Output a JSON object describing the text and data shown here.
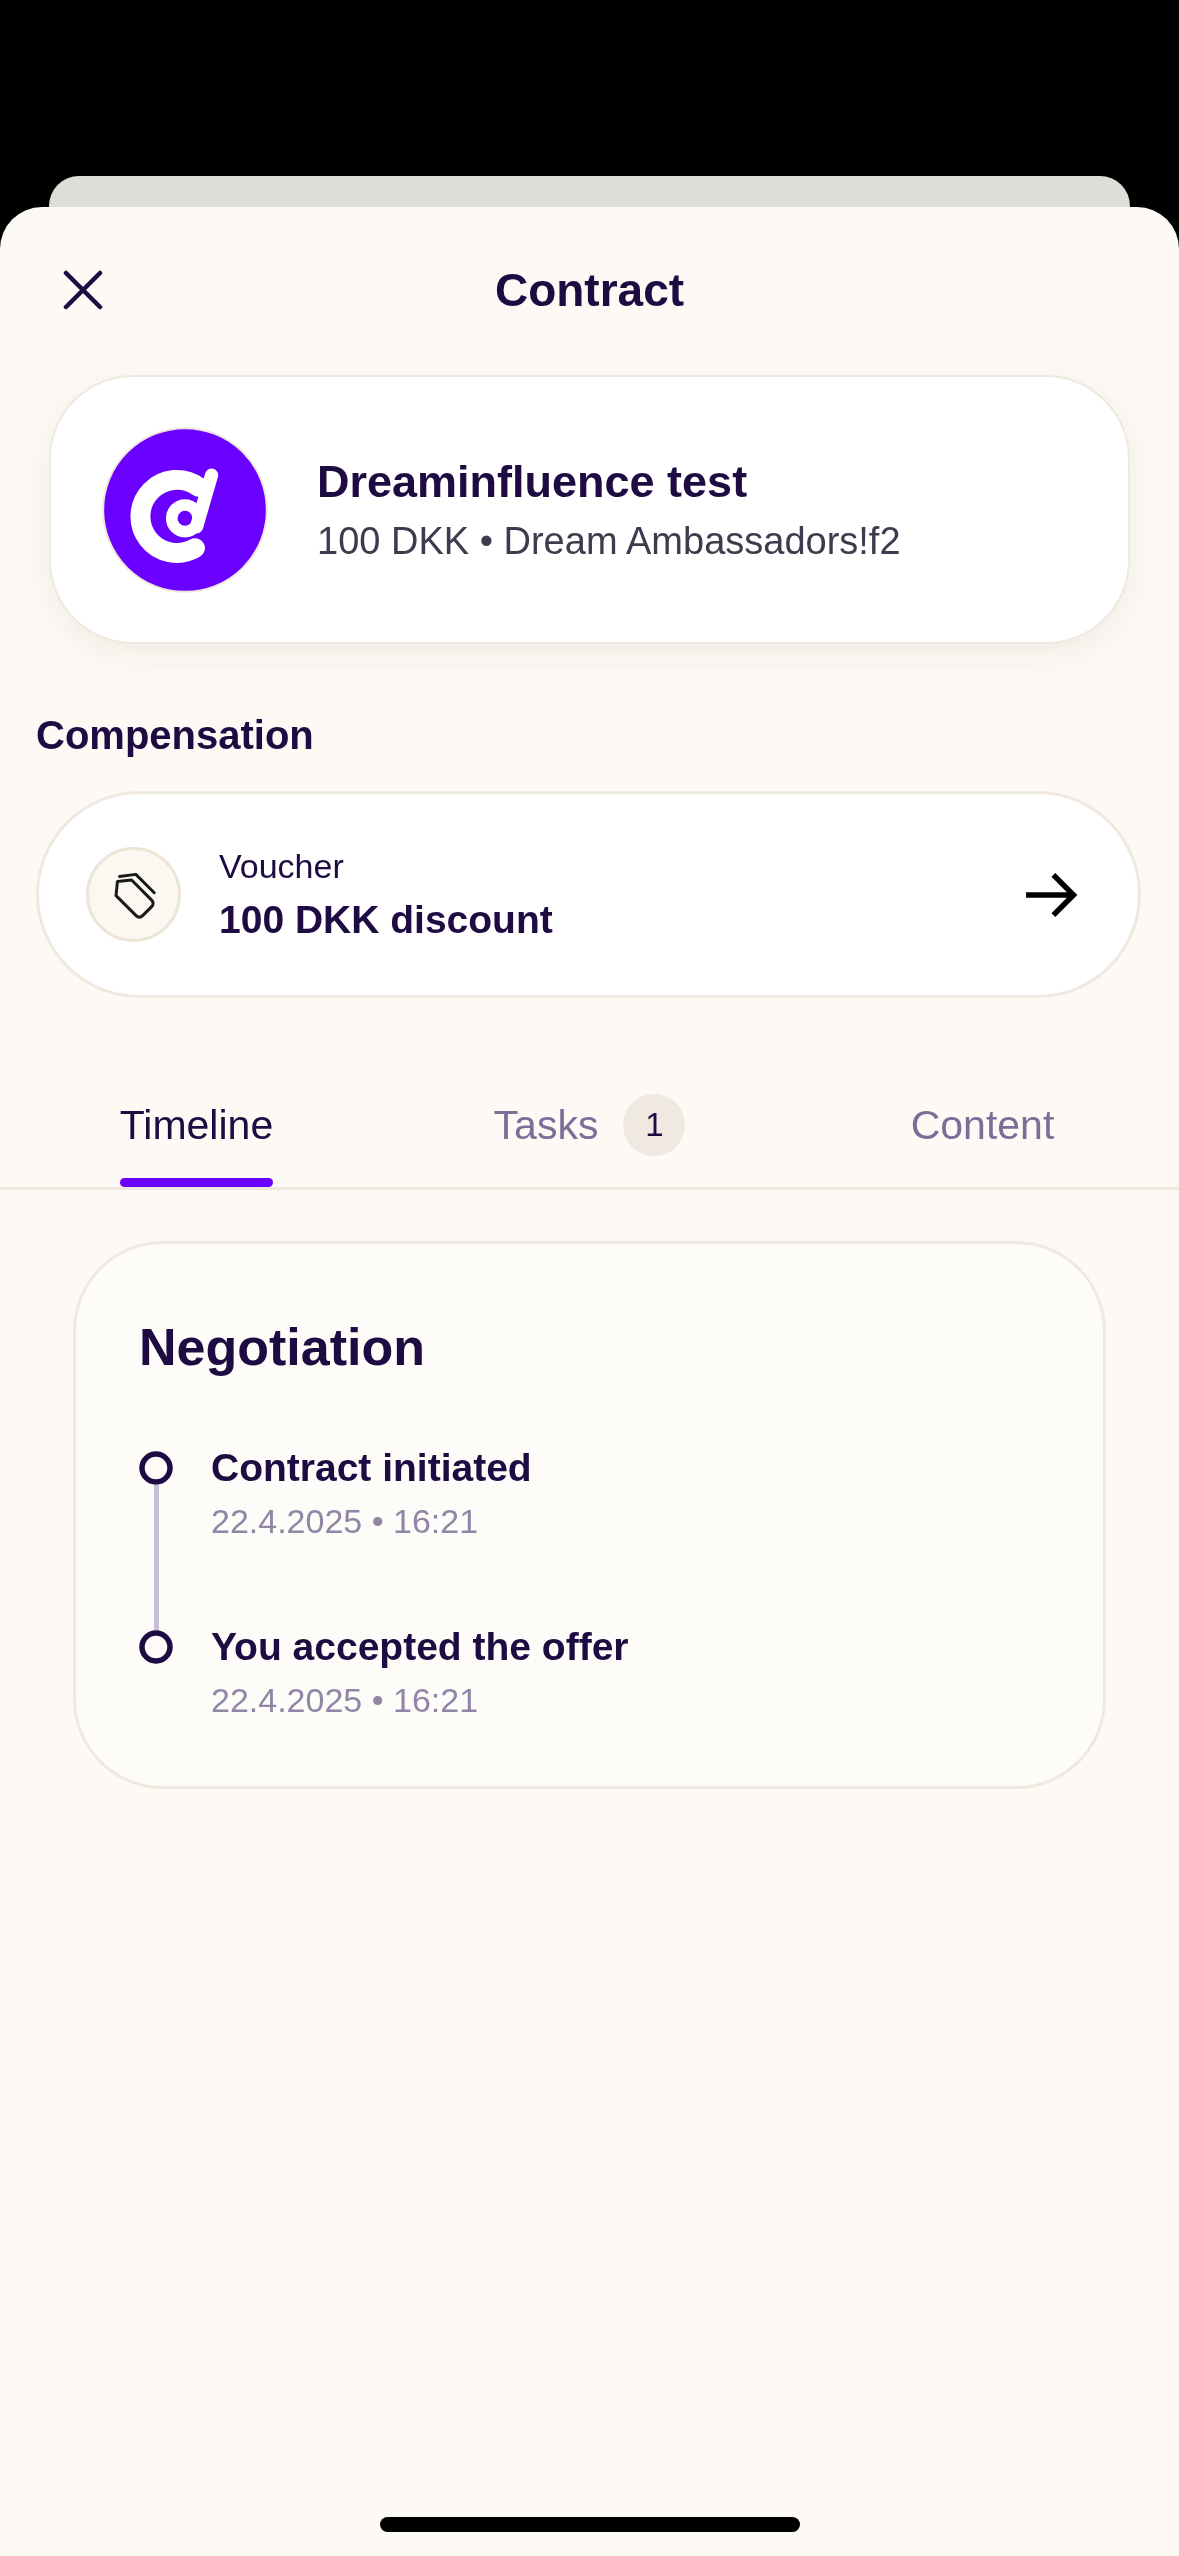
{
  "header": {
    "title": "Contract"
  },
  "contract": {
    "name": "Dreaminfluence test",
    "details": "100 DKK • Dream Ambassadors!f2"
  },
  "compensation": {
    "heading": "Compensation",
    "type": "Voucher",
    "value": "100 DKK discount"
  },
  "tabs": [
    {
      "label": "Timeline",
      "selected": true
    },
    {
      "label": "Tasks",
      "selected": false,
      "badge": "1"
    },
    {
      "label": "Content",
      "selected": false
    }
  ],
  "timeline": {
    "title": "Negotiation",
    "events": [
      {
        "title": "Contract initiated",
        "time": "22.4.2025 • 16:21"
      },
      {
        "title": "You accepted the offer",
        "time": "22.4.2025 • 16:21"
      }
    ]
  }
}
